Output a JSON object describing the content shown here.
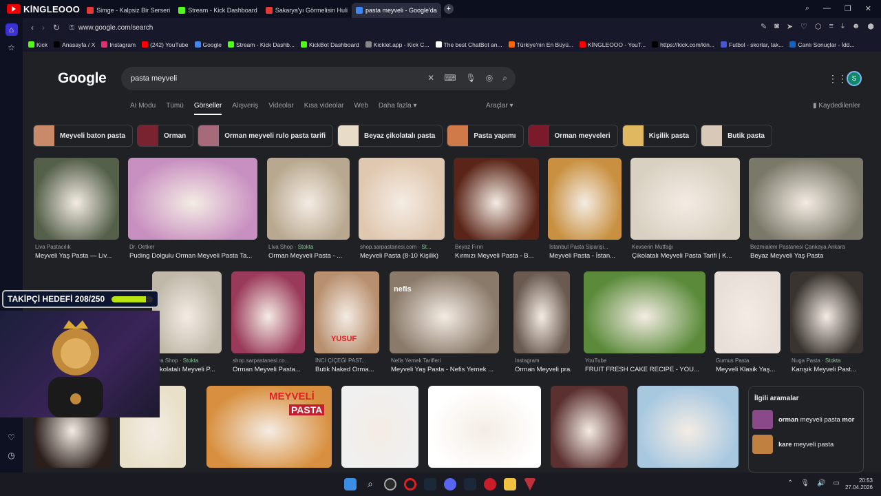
{
  "tabbar": {
    "brand": "KİNGLEOOO",
    "tabs": [
      {
        "label": "Simge - Kalpsiz Bir Serseri",
        "color": "#e53935"
      },
      {
        "label": "Stream - Kick Dashboard",
        "color": "#53fc18"
      },
      {
        "label": "Sakarya'yı Görmelisin Huli",
        "color": "#e53935"
      },
      {
        "label": "pasta meyveli - Google'da",
        "color": "#4285f4"
      }
    ],
    "new_tab": "+"
  },
  "address": {
    "url": "www.google.com/search"
  },
  "bookmarks": [
    {
      "label": "Kick",
      "color": "#53fc18"
    },
    {
      "label": "Anasayfa / X",
      "color": "#000000"
    },
    {
      "label": "Instagram",
      "color": "#e1306c"
    },
    {
      "label": "(242) YouTube",
      "color": "#ff0000"
    },
    {
      "label": "Google",
      "color": "#4285f4"
    },
    {
      "label": "Stream - Kick Dashb...",
      "color": "#53fc18"
    },
    {
      "label": "KickBot Dashboard",
      "color": "#53fc18"
    },
    {
      "label": "Kicklet.app - Kick C...",
      "color": "#888888"
    },
    {
      "label": "The best ChatBot an...",
      "color": "#ffffff"
    },
    {
      "label": "Türkiye'nin En Büyü...",
      "color": "#ff6600"
    },
    {
      "label": "KİNGLEOOO - YouT...",
      "color": "#ff0000"
    },
    {
      "label": "https://kick.com/kin...",
      "color": "#000000"
    },
    {
      "label": "Futbol - skorlar, tak...",
      "color": "#4a55d6"
    },
    {
      "label": "Canlı Sonuçlar - İdd...",
      "color": "#1565c0"
    }
  ],
  "google": {
    "logo": "Google",
    "query": "pasta meyveli",
    "avatar": "S",
    "filter_tabs": [
      "AI Modu",
      "Tümü",
      "Görseller",
      "Alışveriş",
      "Videolar",
      "Kısa videolar",
      "Web",
      "Daha fazla ▾"
    ],
    "tools": "Araçlar ▾",
    "saved": "Kaydedilenler",
    "chips": [
      {
        "label": "Meyveli baton pasta",
        "color": "#c98a6a"
      },
      {
        "label": "Orman",
        "color": "#7a2330"
      },
      {
        "label": "Orman meyveli rulo pasta tarifi",
        "color": "#a66a7a"
      },
      {
        "label": "Beyaz çikolatalı pasta",
        "color": "#e8dcc8"
      },
      {
        "label": "Pasta yapımı",
        "color": "#d07a4a"
      },
      {
        "label": "Orman meyveleri",
        "color": "#7a1a2a"
      },
      {
        "label": "Kişilik pasta",
        "color": "#e0b860"
      },
      {
        "label": "Butik pasta",
        "color": "#d8c8b8"
      }
    ],
    "row1": [
      {
        "source": "Liva Pastacılık",
        "title": "Meyveli Yaş Pasta — Liv...",
        "stock": "",
        "color": "#55604a"
      },
      {
        "source": "Dr. Oetker",
        "title": "Puding Dolgulu Orman Meyveli Pasta Ta...",
        "stock": "",
        "color": "#c890c0"
      },
      {
        "source": "Liva Shop · ",
        "title": "Orman Meyveli Pasta - ...",
        "stock": "Stokta",
        "color": "#b8a890"
      },
      {
        "source": "shop.sarpastanesi.com · ",
        "title": "Meyveli Pasta (8-10 Kişilik)",
        "stock": "St...",
        "color": "#e0c8b0"
      },
      {
        "source": "Beyaz Fırın",
        "title": "Kırmızı Meyveli Pasta - B...",
        "stock": "",
        "color": "#5a2418"
      },
      {
        "source": "İstanbul Pasta Siparişi...",
        "title": "Meyveli Pasta - İstan...",
        "stock": "",
        "color": "#c89040"
      },
      {
        "source": "Kevserin Mutfağı",
        "title": "Çikolatalı Meyveli Pasta Tarifi | K...",
        "stock": "",
        "color": "#d8d0c0"
      },
      {
        "source": "Bezmialem Pastanesi Çankaya Ankara",
        "title": "Beyaz Meyveli Yaş Pasta",
        "stock": "",
        "color": "#7a7868"
      }
    ],
    "row2": [
      {
        "source": "Liva Shop · ",
        "title": "Çikolatalı Meyveli P...",
        "stock": "Stokta",
        "color": "#c0b8a8"
      },
      {
        "source": "shop.sarpastanesi.co...",
        "title": "Orman Meyveli Pasta...",
        "stock": "",
        "color": "#9a3a5a"
      },
      {
        "source": "İNCİ ÇİÇEĞİ PAST...",
        "title": "Butik Naked Orma...",
        "stock": "",
        "color": "#b89070"
      },
      {
        "source": "Nefis Yemek Tarifleri",
        "title": "Meyveli Yaş Pasta - Nefis Yemek ...",
        "stock": "",
        "color": "#8a7a6a"
      },
      {
        "source": "Instagram",
        "title": "Orman Meyveli pra...",
        "stock": "",
        "color": "#6a5a50"
      },
      {
        "source": "YouTube",
        "title": "FRUIT FRESH CAKE RECIPE - YOU...",
        "stock": "",
        "color": "#5a8a3a"
      },
      {
        "source": "Gumus Pasta",
        "title": "Meyveli Klasik Yaş...",
        "stock": "",
        "color": "#e8e0d8"
      },
      {
        "source": "Nuga Pasta · ",
        "title": "Karışık Meyveli Past...",
        "stock": "Stokta",
        "color": "#3a3430"
      }
    ],
    "row3": [
      {
        "color": "#2a1e1a"
      },
      {
        "color": "#e8e0c8"
      },
      {
        "color": "#d89040"
      },
      {
        "color": "#f0f0f0"
      },
      {
        "color": "#ffffff"
      },
      {
        "color": "#5a3030"
      },
      {
        "color": "#a8c8e0"
      }
    ],
    "overlay_text": {
      "banner1": "MEYVELİ",
      "banner2": "PASTA",
      "yusuf": "YUSUF",
      "nefis": "nefis"
    },
    "related": {
      "title": "İlgili aramalar",
      "items": [
        {
          "bold": "orman",
          "rest": " meyveli pasta ",
          "bold2": "mor",
          "color": "#8a4a8a"
        },
        {
          "bold": "kare",
          "rest": " meyveli pasta",
          "bold2": "",
          "color": "#c08040"
        }
      ]
    }
  },
  "stream_overlay": {
    "goal_label": "TAKİPÇİ HEDEFİ 208/250",
    "goal_fraction": 0.832,
    "bar_color": "#b7e50b"
  },
  "taskbar": {
    "time": "20:53",
    "date": "27.04.2026"
  }
}
